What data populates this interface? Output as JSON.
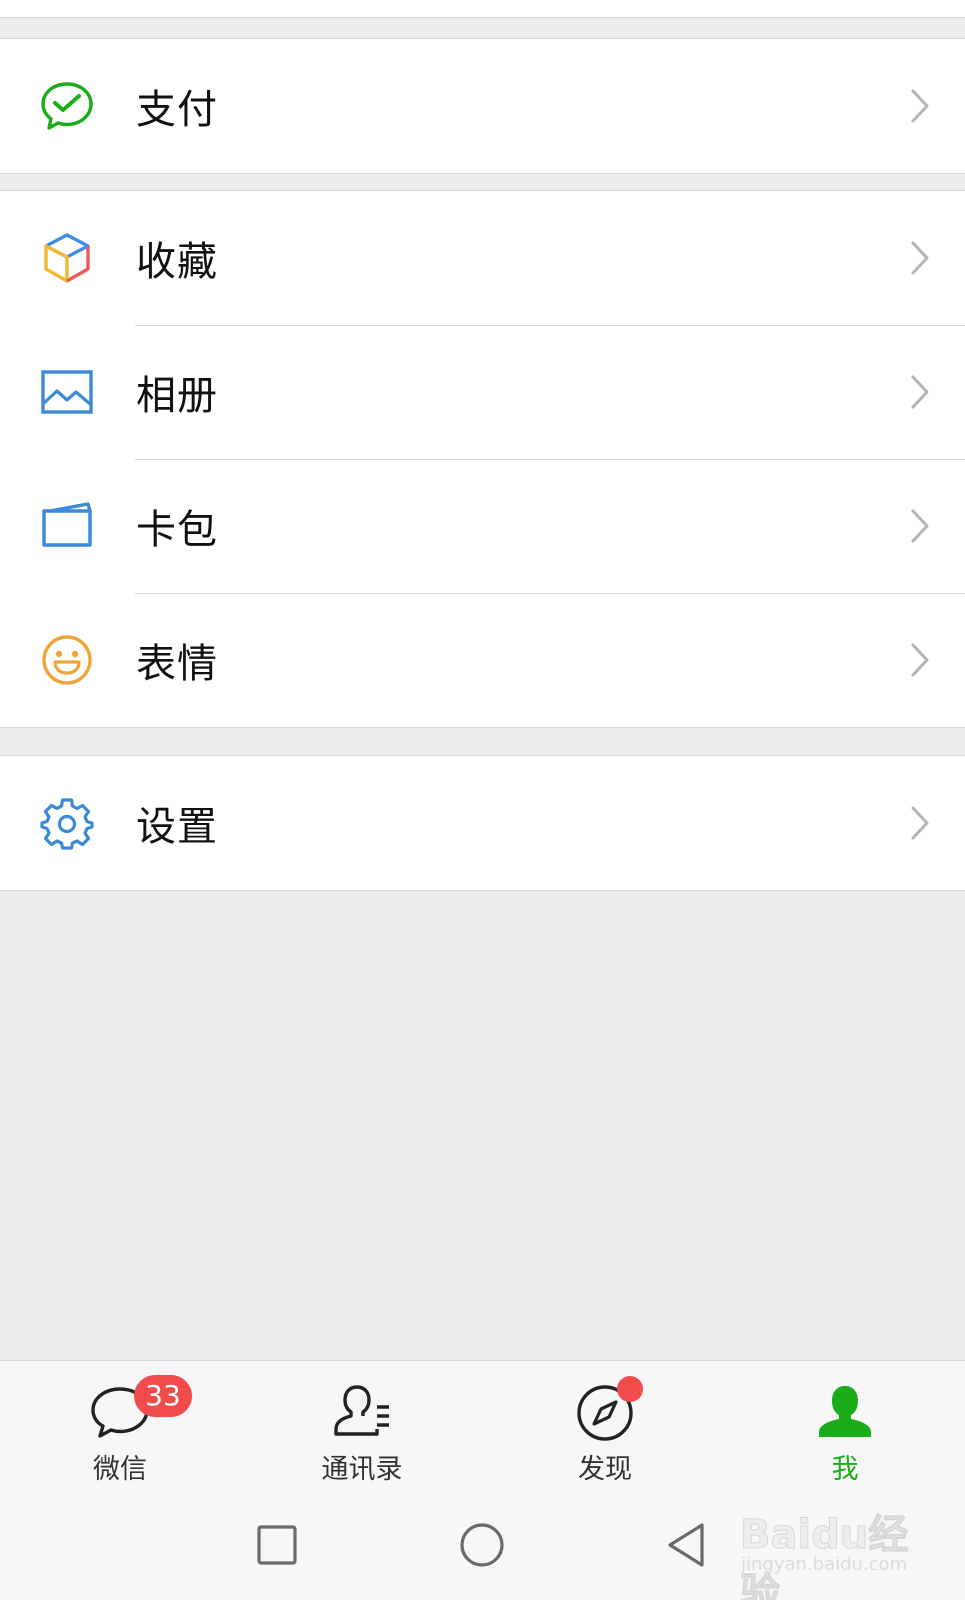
{
  "menu": {
    "pay": {
      "label": "支付",
      "icon": "wechat-pay-icon"
    },
    "favorites": {
      "label": "收藏",
      "icon": "cube-icon"
    },
    "album": {
      "label": "相册",
      "icon": "image-icon"
    },
    "card_package": {
      "label": "卡包",
      "icon": "card-icon"
    },
    "stickers": {
      "label": "表情",
      "icon": "smiley-icon"
    },
    "settings": {
      "label": "设置",
      "icon": "gear-icon"
    }
  },
  "tabbar": {
    "tabs": [
      {
        "label": "微信",
        "icon": "chat-bubble-icon",
        "badge": "33"
      },
      {
        "label": "通讯录",
        "icon": "contacts-icon"
      },
      {
        "label": "发现",
        "icon": "compass-icon",
        "dot": true
      },
      {
        "label": "我",
        "icon": "person-icon",
        "active": true
      }
    ]
  },
  "navigation": [
    "square-icon",
    "circle-icon",
    "back-triangle-icon"
  ],
  "watermark": {
    "logo": "Baidu经验",
    "url": "jingyan.baidu.com"
  },
  "colors": {
    "accent": "#1aad19",
    "badge": "#f14b4b",
    "background": "#ededef",
    "divider": "#d9d9d9"
  }
}
